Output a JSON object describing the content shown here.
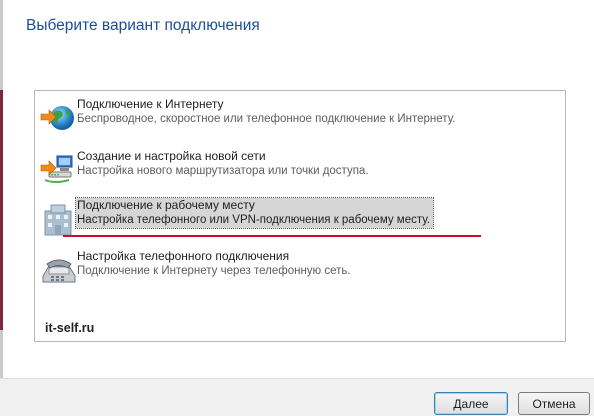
{
  "dialog": {
    "title": "Выберите вариант подключения"
  },
  "options": [
    {
      "title": "Подключение к Интернету",
      "description": "Беспроводное, скоростное или телефонное подключение к Интернету.",
      "icon": "globe-internet-icon",
      "selected": false
    },
    {
      "title": "Создание и настройка новой сети",
      "description": "Настройка нового маршрутизатора или точки доступа.",
      "icon": "network-setup-icon",
      "selected": false
    },
    {
      "title": "Подключение к рабочему месту",
      "description": "Настройка телефонного или VPN-подключения к рабочему месту.",
      "icon": "workplace-building-icon",
      "selected": true
    },
    {
      "title": "Настройка телефонного подключения",
      "description": "Подключение к Интернету через телефонную сеть.",
      "icon": "phone-modem-icon",
      "selected": false
    }
  ],
  "watermark": "it-self.ru",
  "buttons": {
    "next": "Далее",
    "cancel": "Отмена"
  },
  "colors": {
    "title": "#1a4e9c",
    "underline": "#c8102e",
    "selection": "#d6d6d6"
  }
}
